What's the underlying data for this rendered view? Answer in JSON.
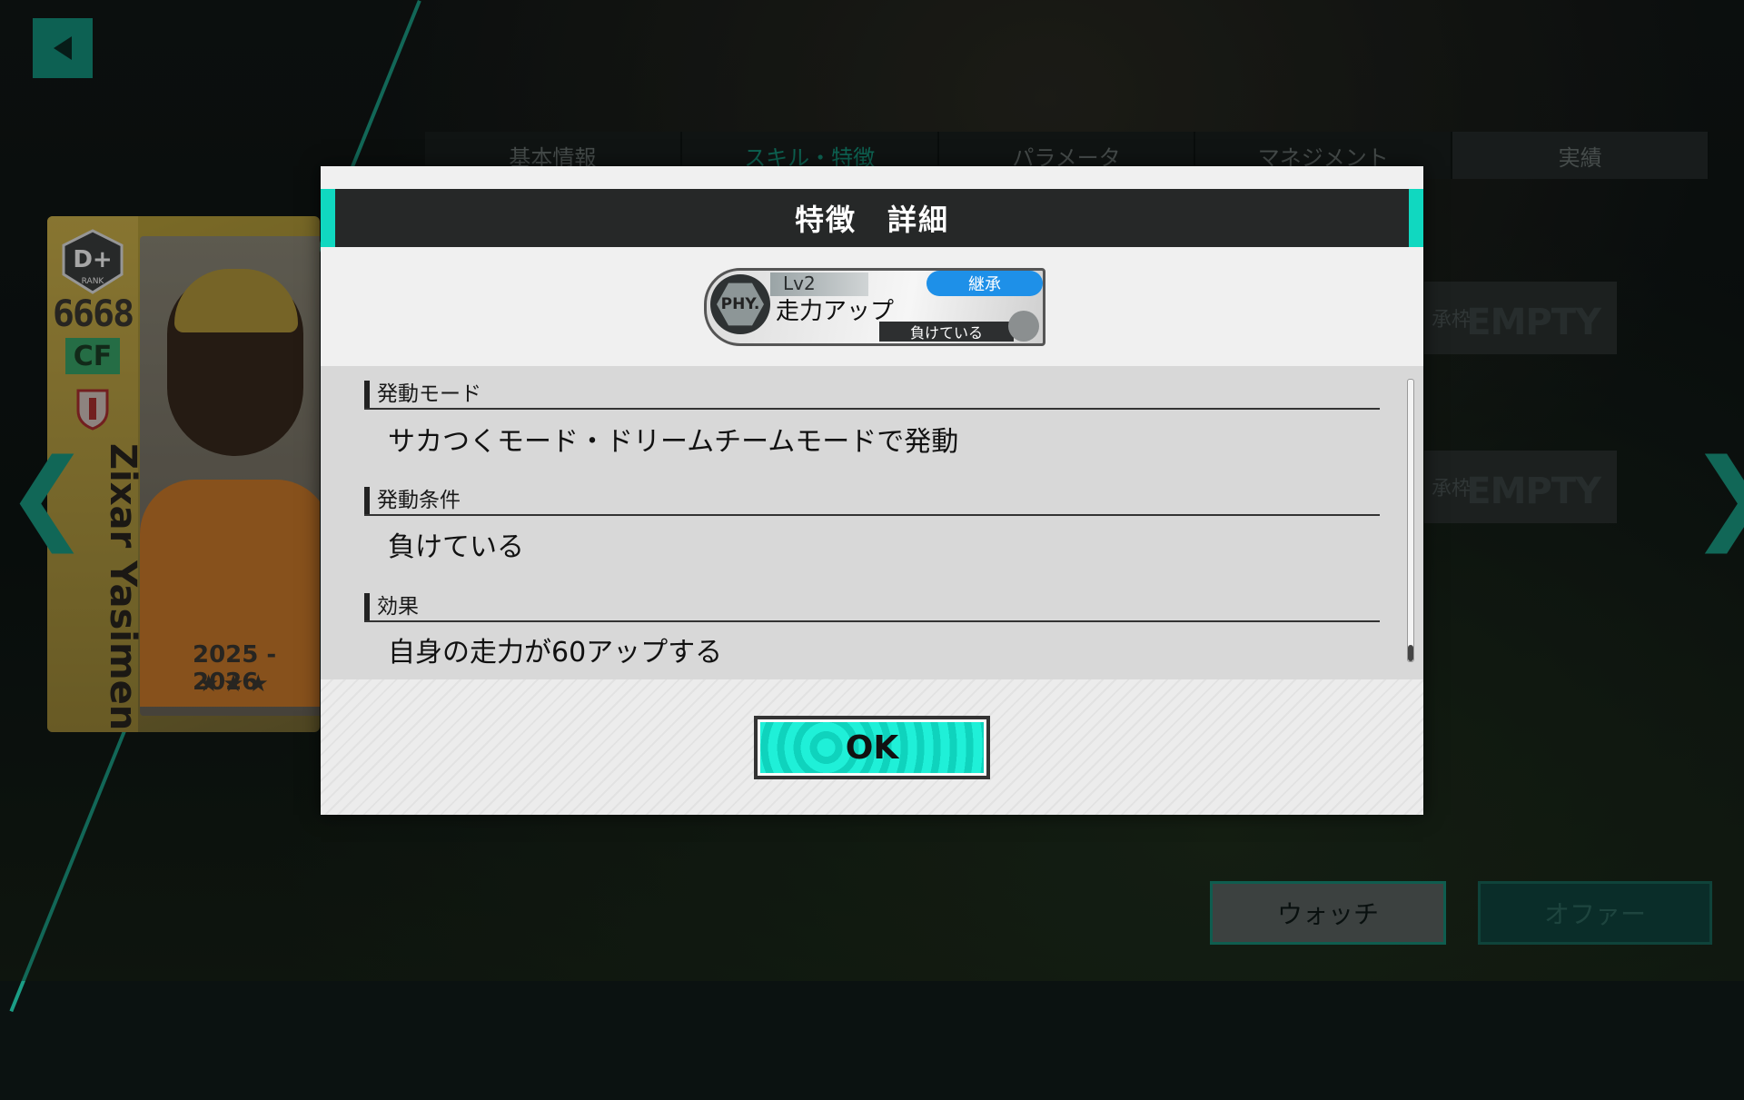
{
  "tabs": [
    "基本情報",
    "スキル・特徴",
    "パラメータ",
    "マネジメント",
    "実績"
  ],
  "card": {
    "rank": "D+",
    "rank_sub": "RANK",
    "rating": "6668",
    "position": "CF",
    "name": "Zixar Yasimen",
    "season": "2025 - 2026",
    "stars": "★★★"
  },
  "slots": [
    {
      "label": "承枠",
      "value": "EMPTY"
    },
    {
      "label": "承枠",
      "value": "EMPTY"
    }
  ],
  "buttons": {
    "watch": "ウォッチ",
    "offer": "オファー",
    "ok": "OK"
  },
  "modal": {
    "title": "特徴　詳細",
    "skill": {
      "icon_text": "PHY.",
      "level": "Lv2",
      "inherit": "継承",
      "name": "走力アップ",
      "condition": "負けている"
    },
    "sections": [
      {
        "title": "発動モード",
        "body": "サカつくモード・ドリームチームモードで発動"
      },
      {
        "title": "発動条件",
        "body": "負けている"
      },
      {
        "title": "効果",
        "body": "自身の走力が60アップする"
      }
    ]
  },
  "colors": {
    "accent": "#10d8c0",
    "inherit_badge": "#1e90e8",
    "ok_button": "#1ff0d8"
  }
}
